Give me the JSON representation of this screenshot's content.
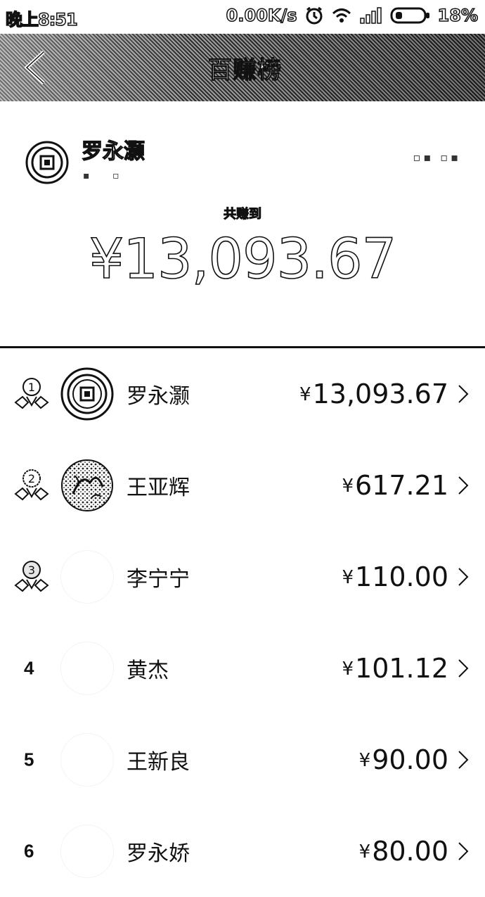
{
  "status_bar": {
    "time": "晚上8:51",
    "network_speed": "0.00K/s",
    "battery": "18%",
    "icons": [
      "alarm-icon",
      "wifi-icon",
      "signal-icon",
      "battery-icon"
    ]
  },
  "header": {
    "title": "百赚榜",
    "back_icon": "chevron-left-icon"
  },
  "summary": {
    "user_name": "罗永灏",
    "earned_label": "共赚到",
    "total": "¥13,093.67"
  },
  "ranking": [
    {
      "rank": "1",
      "name": "罗永灏",
      "amount": "13,093.67",
      "currency": "¥",
      "medal": "gold"
    },
    {
      "rank": "2",
      "name": "王亚辉",
      "amount": "617.21",
      "currency": "¥",
      "medal": "silver"
    },
    {
      "rank": "3",
      "name": "李宁宁",
      "amount": "110.00",
      "currency": "¥",
      "medal": "bronze"
    },
    {
      "rank": "4",
      "name": "黄杰",
      "amount": "101.12",
      "currency": "¥"
    },
    {
      "rank": "5",
      "name": "王新良",
      "amount": "90.00",
      "currency": "¥"
    },
    {
      "rank": "6",
      "name": "罗永娇",
      "amount": "80.00",
      "currency": "¥"
    }
  ],
  "colors": {
    "text": "#111111",
    "background": "#ffffff",
    "divider": "#111111"
  }
}
